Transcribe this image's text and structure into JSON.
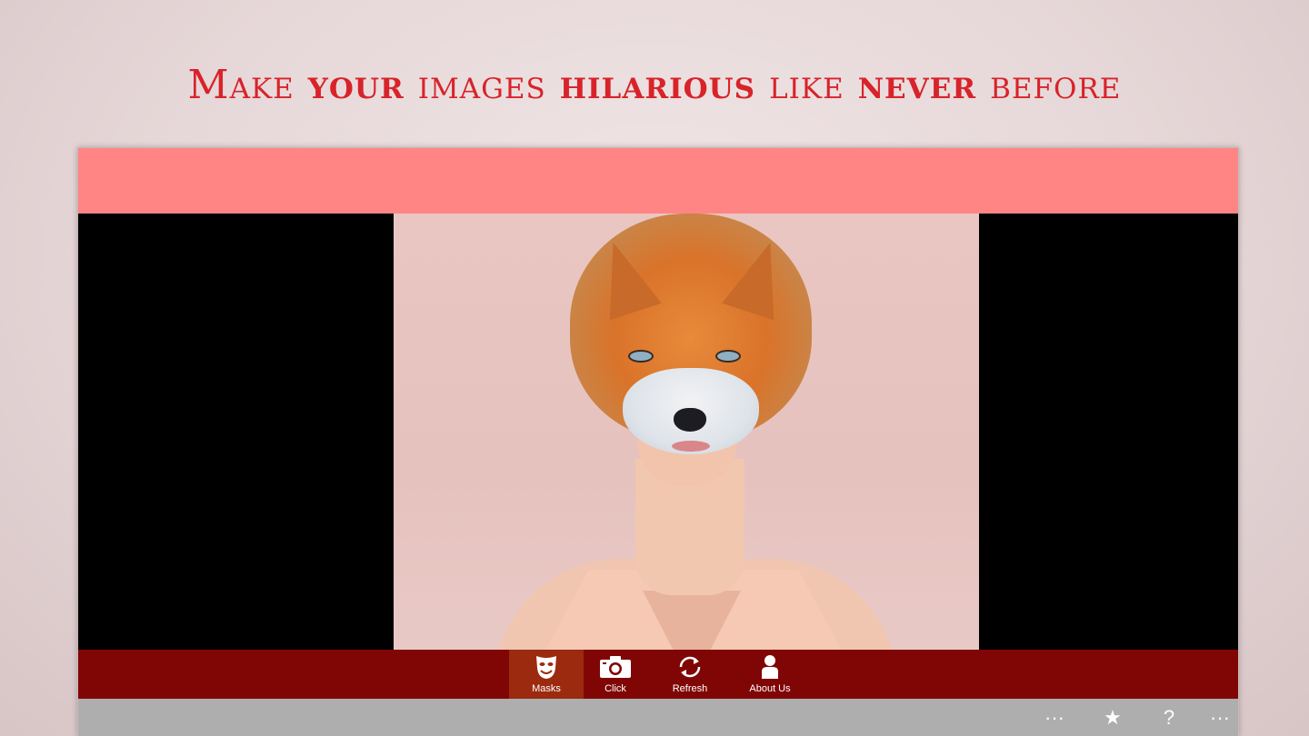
{
  "headline": {
    "w1": "Make",
    "w2": "your",
    "w3": "images",
    "w4": "hilarious",
    "w5": "like",
    "w6": "never",
    "w7": "before"
  },
  "colors": {
    "headline": "#d8232a",
    "app_header": "#ff8585",
    "toolbar": "#800606",
    "toolbar_active": "#9b2a0f",
    "appbar": "#aeaeae"
  },
  "toolbar": {
    "items": [
      {
        "label": "Masks",
        "icon": "theater-mask-icon",
        "active": true
      },
      {
        "label": "Click",
        "icon": "camera-icon"
      },
      {
        "label": "Refresh",
        "icon": "refresh-icon"
      },
      {
        "label": "About Us",
        "icon": "person-icon"
      }
    ]
  },
  "appbar": {
    "more_left": "···",
    "star": "★",
    "help": "?",
    "more_right": "···"
  }
}
